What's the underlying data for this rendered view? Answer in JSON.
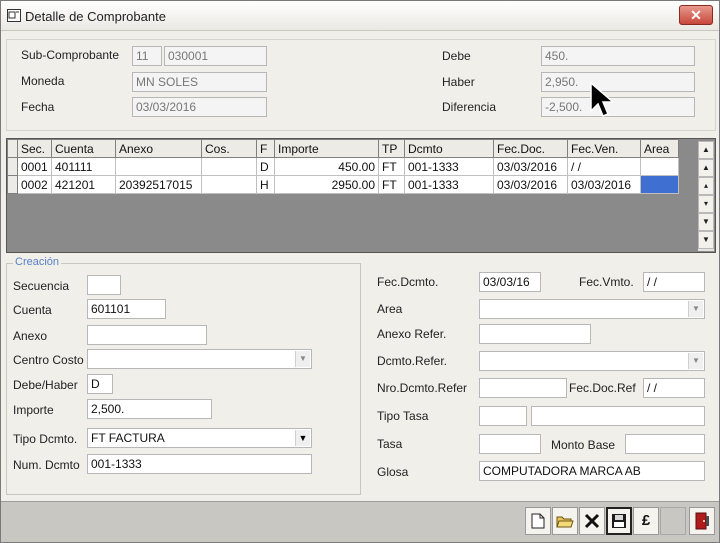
{
  "window": {
    "title": "Detalle de Comprobante",
    "close_label": "✕"
  },
  "header": {
    "subcomprobante_label": "Sub-Comprobante",
    "subcomprobante_code": "11",
    "subcomprobante_num": "030001",
    "moneda_label": "Moneda",
    "moneda_value": "MN      SOLES",
    "fecha_label": "Fecha",
    "fecha_value": "03/03/2016",
    "debe_label": "Debe",
    "debe_value": "450.",
    "haber_label": "Haber",
    "haber_value": "2,950.",
    "diferencia_label": "Diferencia",
    "diferencia_value": "-2,500."
  },
  "grid": {
    "columns": [
      "Sec.",
      "Cuenta",
      "Anexo",
      "Cos.",
      "F",
      "Importe",
      "TP",
      "Dcmto",
      "Fec.Doc.",
      "Fec.Ven.",
      "Area"
    ],
    "rows": [
      [
        "0001",
        "401111",
        "",
        "",
        "D",
        "450.00",
        "FT",
        "001-1333",
        "03/03/2016",
        " /  /",
        ""
      ],
      [
        "0002",
        "421201",
        "20392517015",
        "",
        "H",
        "2950.00",
        "FT",
        "001-1333",
        "03/03/2016",
        "03/03/2016",
        ""
      ]
    ]
  },
  "creacion": {
    "legend": "Creación",
    "secuencia_label": "Secuencia",
    "secuencia_value": "",
    "cuenta_label": "Cuenta",
    "cuenta_value": "601101",
    "anexo_label": "Anexo",
    "anexo_value": "",
    "centro_costo_label": "Centro Costo",
    "centro_costo_value": "",
    "debe_haber_label": "Debe/Haber",
    "debe_haber_value": "D",
    "importe_label": "Importe",
    "importe_value": "2,500.",
    "tipo_dcmto_label": "Tipo Dcmto.",
    "tipo_dcmto_value": "FT      FACTURA",
    "num_dcmto_label": "Num. Dcmto",
    "num_dcmto_value": "001-1333"
  },
  "right": {
    "fec_dcmto_label": "Fec.Dcmto.",
    "fec_dcmto_value": "03/03/16",
    "fec_vmto_label": "Fec.Vmto.",
    "fec_vmto_value": " /  /",
    "area_label": "Area",
    "anexo_refer_label": "Anexo Refer.",
    "dcmto_refer_label": "Dcmto.Refer.",
    "nro_dcmto_refer_label": "Nro.Dcmto.Refer",
    "fec_doc_ref_label": "Fec.Doc.Ref",
    "fec_doc_ref_value": " /  /",
    "tipo_tasa_label": "Tipo Tasa",
    "tasa_label": "Tasa",
    "monto_base_label": "Monto Base",
    "glosa_label": "Glosa",
    "glosa_value": "COMPUTADORA MARCA AB"
  },
  "toolbar": {
    "pound_label": "£"
  },
  "icons": [
    "window-icon",
    "close-icon",
    "new-document-icon",
    "open-folder-icon",
    "delete-x-icon",
    "save-disk-icon",
    "exit-door-icon",
    "mouse-cursor-icon"
  ]
}
